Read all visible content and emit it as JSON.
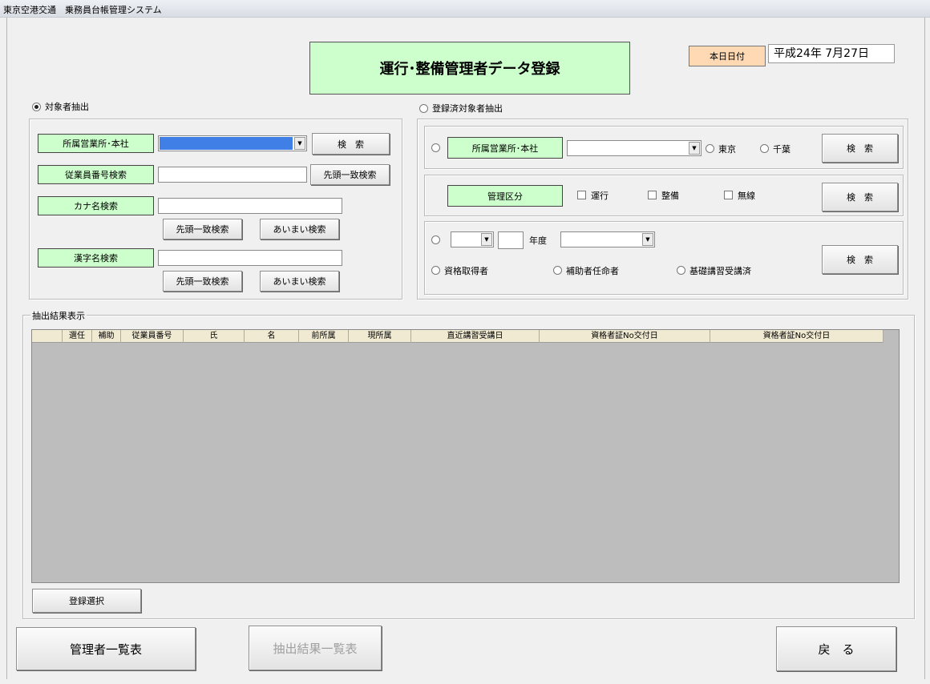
{
  "window": {
    "title": "東京空港交通　乗務員台帳管理システム"
  },
  "header": {
    "title": "運行･整備管理者データ登録",
    "date_label": "本日日付",
    "date_value": "平成24年 7月27日"
  },
  "left_panel": {
    "radio_label": "対象者抽出",
    "office_label": "所属営業所･本社",
    "search_button": "検　索",
    "employee_label": "従業員番号検索",
    "prefix_button": "先頭一致検索",
    "kana_label": "カナ名検索",
    "kana_prefix_button": "先頭一致検索",
    "kana_fuzzy_button": "あいまい検索",
    "kanji_label": "漢字名検索",
    "kanji_prefix_button": "先頭一致検索",
    "kanji_fuzzy_button": "あいまい検索"
  },
  "right_panel": {
    "radio_label": "登録済対象者抽出",
    "office_label": "所属営業所･本社",
    "tokyo": "東京",
    "chiba": "千葉",
    "search1": "検　索",
    "category_label": "管理区分",
    "cb_operation": "運行",
    "cb_maintenance": "整備",
    "cb_radio": "無線",
    "search2": "検　索",
    "year_label": "年度",
    "qualified": "資格取得者",
    "assistant": "補助者任命者",
    "basic_course": "基礎講習受講済",
    "search3": "検　索"
  },
  "results": {
    "caption": "抽出結果表示",
    "columns": [
      "",
      "選任",
      "補助",
      "従業員番号",
      "氏",
      "名",
      "前所属",
      "現所属",
      "直近講習受講日",
      "資格者証No交付日",
      "資格者証No交付日"
    ],
    "register_button": "登録選択"
  },
  "footer": {
    "manager_list": "管理者一覧表",
    "extract_list": "抽出結果一覧表",
    "back": "戻　る"
  }
}
